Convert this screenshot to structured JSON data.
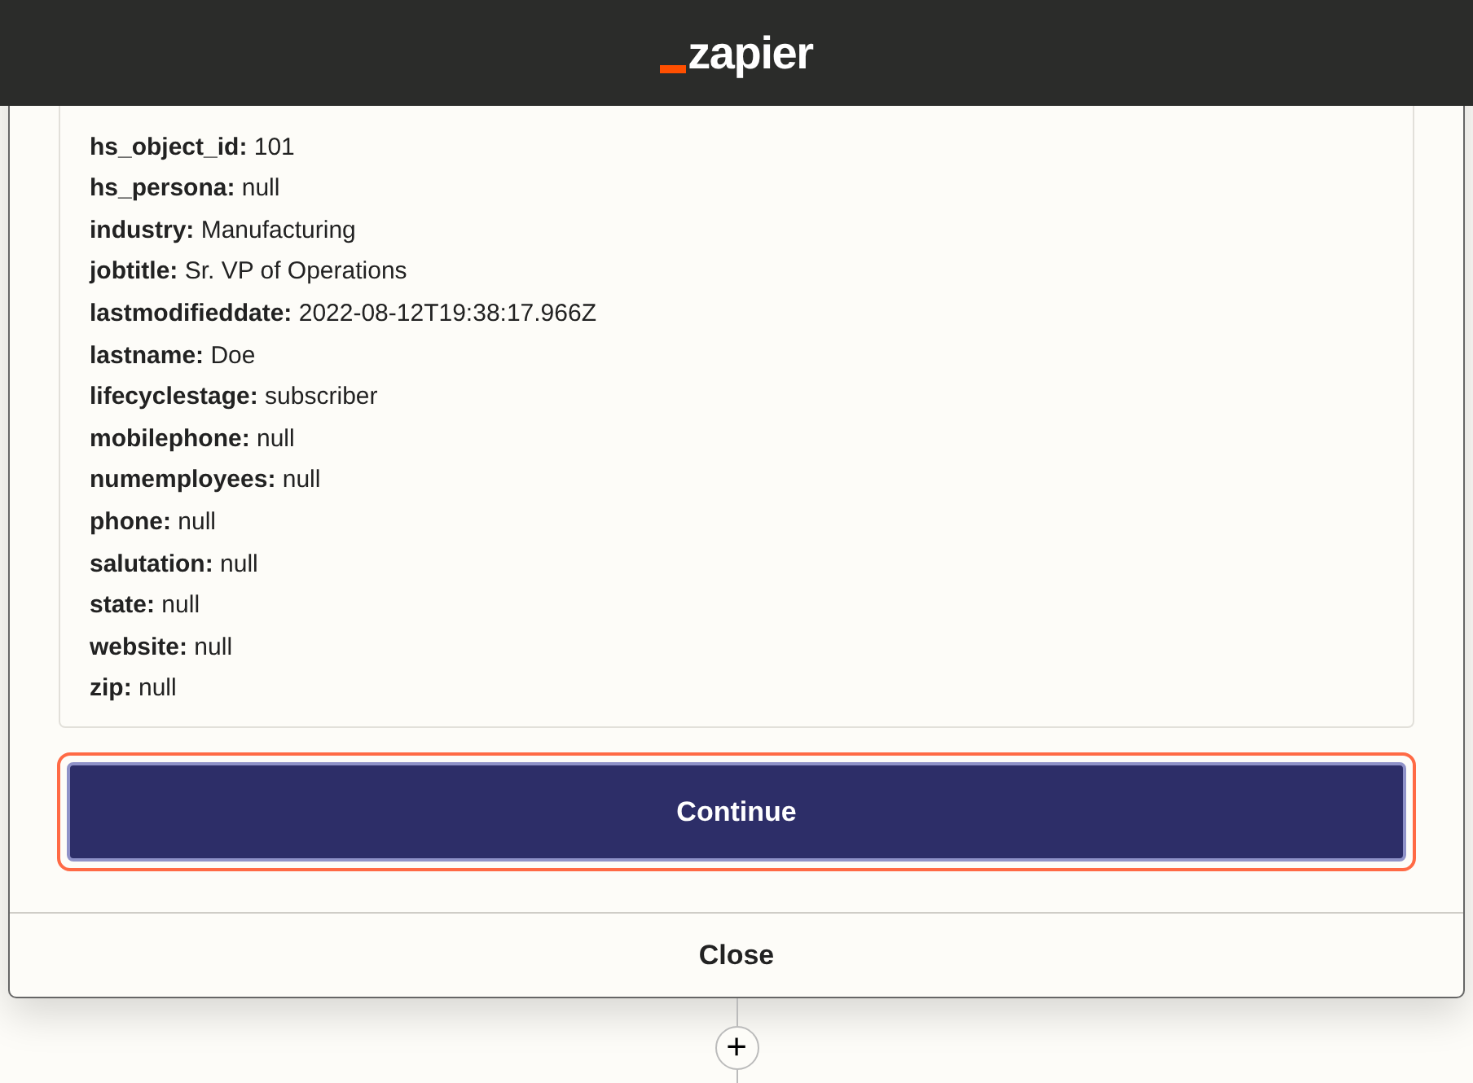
{
  "header": {
    "logo_text": "zapier"
  },
  "fields": [
    {
      "key": "hs_object_id:",
      "value": "101"
    },
    {
      "key": "hs_persona:",
      "value": "null"
    },
    {
      "key": "industry:",
      "value": "Manufacturing"
    },
    {
      "key": "jobtitle:",
      "value": "Sr. VP of Operations"
    },
    {
      "key": "lastmodifieddate:",
      "value": "2022-08-12T19:38:17.966Z"
    },
    {
      "key": "lastname:",
      "value": "Doe"
    },
    {
      "key": "lifecyclestage:",
      "value": "subscriber"
    },
    {
      "key": "mobilephone:",
      "value": "null"
    },
    {
      "key": "numemployees:",
      "value": "null"
    },
    {
      "key": "phone:",
      "value": "null"
    },
    {
      "key": "salutation:",
      "value": "null"
    },
    {
      "key": "state:",
      "value": "null"
    },
    {
      "key": "website:",
      "value": "null"
    },
    {
      "key": "zip:",
      "value": "null"
    }
  ],
  "continue_button": {
    "label": "Continue"
  },
  "close_button": {
    "label": "Close"
  },
  "add_step": {
    "label": "+"
  }
}
